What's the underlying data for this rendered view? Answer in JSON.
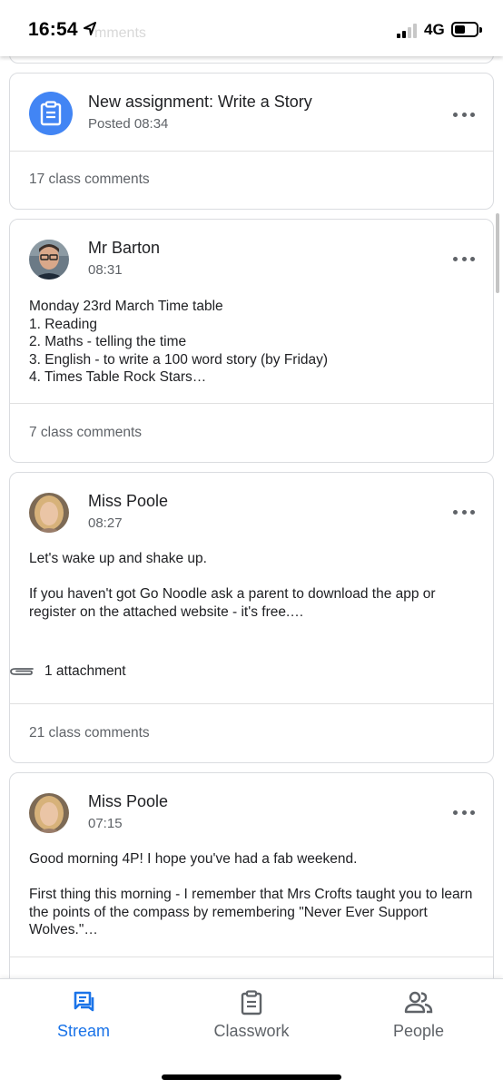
{
  "status_bar": {
    "time": "16:54",
    "network": "4G",
    "ghost_text": "mments"
  },
  "feed": {
    "assignment_card": {
      "title": "New assignment: Write a Story",
      "subtitle": "Posted 08:34",
      "comments": "17 class comments"
    },
    "posts": [
      {
        "author": "Mr Barton",
        "time": "08:31",
        "body": "Monday 23rd March Time table\n1. Reading\n2. Maths - telling the time\n3. English - to write a 100 word story (by Friday)\n4. Times Table Rock Stars…",
        "comments": "7 class comments"
      },
      {
        "author": "Miss Poole",
        "time": "08:27",
        "body": "Let's wake up and shake up.\n\nIf you haven't got Go Noodle ask a parent to download the app or register on the attached website - it's free.…",
        "attachment": "1 attachment",
        "comments": "21 class comments"
      },
      {
        "author": "Miss Poole",
        "time": "07:15",
        "body": "Good morning 4P! I hope you've had a fab weekend.\n\nFirst thing this morning - I remember that Mrs Crofts taught you to learn the points of the compass by remembering \"Never Ever Support Wolves.\"…"
      }
    ]
  },
  "bottom_nav": {
    "items": [
      {
        "label": "Stream",
        "icon": "stream-icon",
        "active": true
      },
      {
        "label": "Classwork",
        "icon": "classwork-icon",
        "active": false
      },
      {
        "label": "People",
        "icon": "people-icon",
        "active": false
      }
    ]
  },
  "colors": {
    "accent": "#1a73e8",
    "assignment_icon_bg": "#4285f4",
    "secondary_text": "#5f6368",
    "border": "#dadce0"
  }
}
